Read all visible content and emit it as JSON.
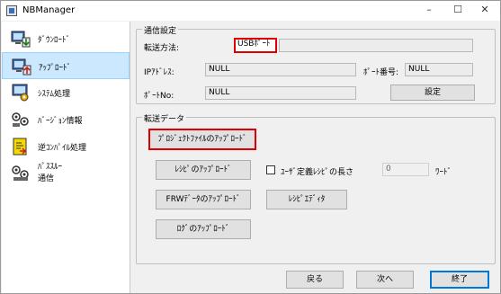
{
  "window": {
    "title": "NBManager"
  },
  "titlebar": {
    "minimize": "–",
    "maximize": "☐",
    "close": "✕"
  },
  "sidebar": {
    "items": [
      {
        "label": "ﾀﾞｳﾝﾛｰﾄﾞ",
        "icon": "download-icon"
      },
      {
        "label": "ｱｯﾌﾟﾛｰﾄﾞ",
        "icon": "upload-icon",
        "active": true
      },
      {
        "label": "ｼｽﾃﾑ処理",
        "icon": "system-processing-icon"
      },
      {
        "label": "ﾊﾞｰｼﾞｮﾝ情報",
        "icon": "version-info-icon"
      },
      {
        "label": "逆ｺﾝﾊﾟｲﾙ処理",
        "icon": "decompile-icon"
      },
      {
        "label_line1": "ﾊﾟｽｽﾙｰ",
        "label_line2": "通信",
        "icon": "pass-through-icon"
      }
    ]
  },
  "comm": {
    "legend": "通信設定",
    "method_label": "転送方法:",
    "method_value": "USBﾎﾟｰﾄ",
    "ip_label": "IPｱﾄﾞﾚｽ:",
    "ip_value": "NULL",
    "port_label": "ﾎﾟｰﾄ番号:",
    "port_value": "NULL",
    "portno_label": "ﾎﾟｰﾄNo:",
    "portno_value": "NULL",
    "settings_button": "設定"
  },
  "transfer": {
    "legend": "転送データ",
    "project_button": "ﾌﾟﾛｼﾞｪｸﾄﾌｧｲﾙのｱｯﾌﾟﾛｰﾄﾞ",
    "recipe_button": "ﾚｼﾋﾟのｱｯﾌﾟﾛｰﾄﾞ",
    "frw_button": "FRWﾃﾞｰﾀのｱｯﾌﾟﾛｰﾄﾞ",
    "log_button": "ﾛｸﾞのｱｯﾌﾟﾛｰﾄﾞ",
    "recipe_editor_button": "ﾚｼﾋﾟｴﾃﾞｨﾀ",
    "user_len_label": "ﾕｰｻﾞ定義ﾚｼﾋﾟの長さ",
    "user_len_checked": false,
    "user_len_value": "0",
    "user_len_unit": "ﾜｰﾄﾞ"
  },
  "footer": {
    "back": "戻る",
    "next": "次へ",
    "finish": "終了"
  },
  "colors": {
    "highlight": "#e00000",
    "selected_bg": "#cce8ff",
    "selected_border": "#99d1ff"
  }
}
